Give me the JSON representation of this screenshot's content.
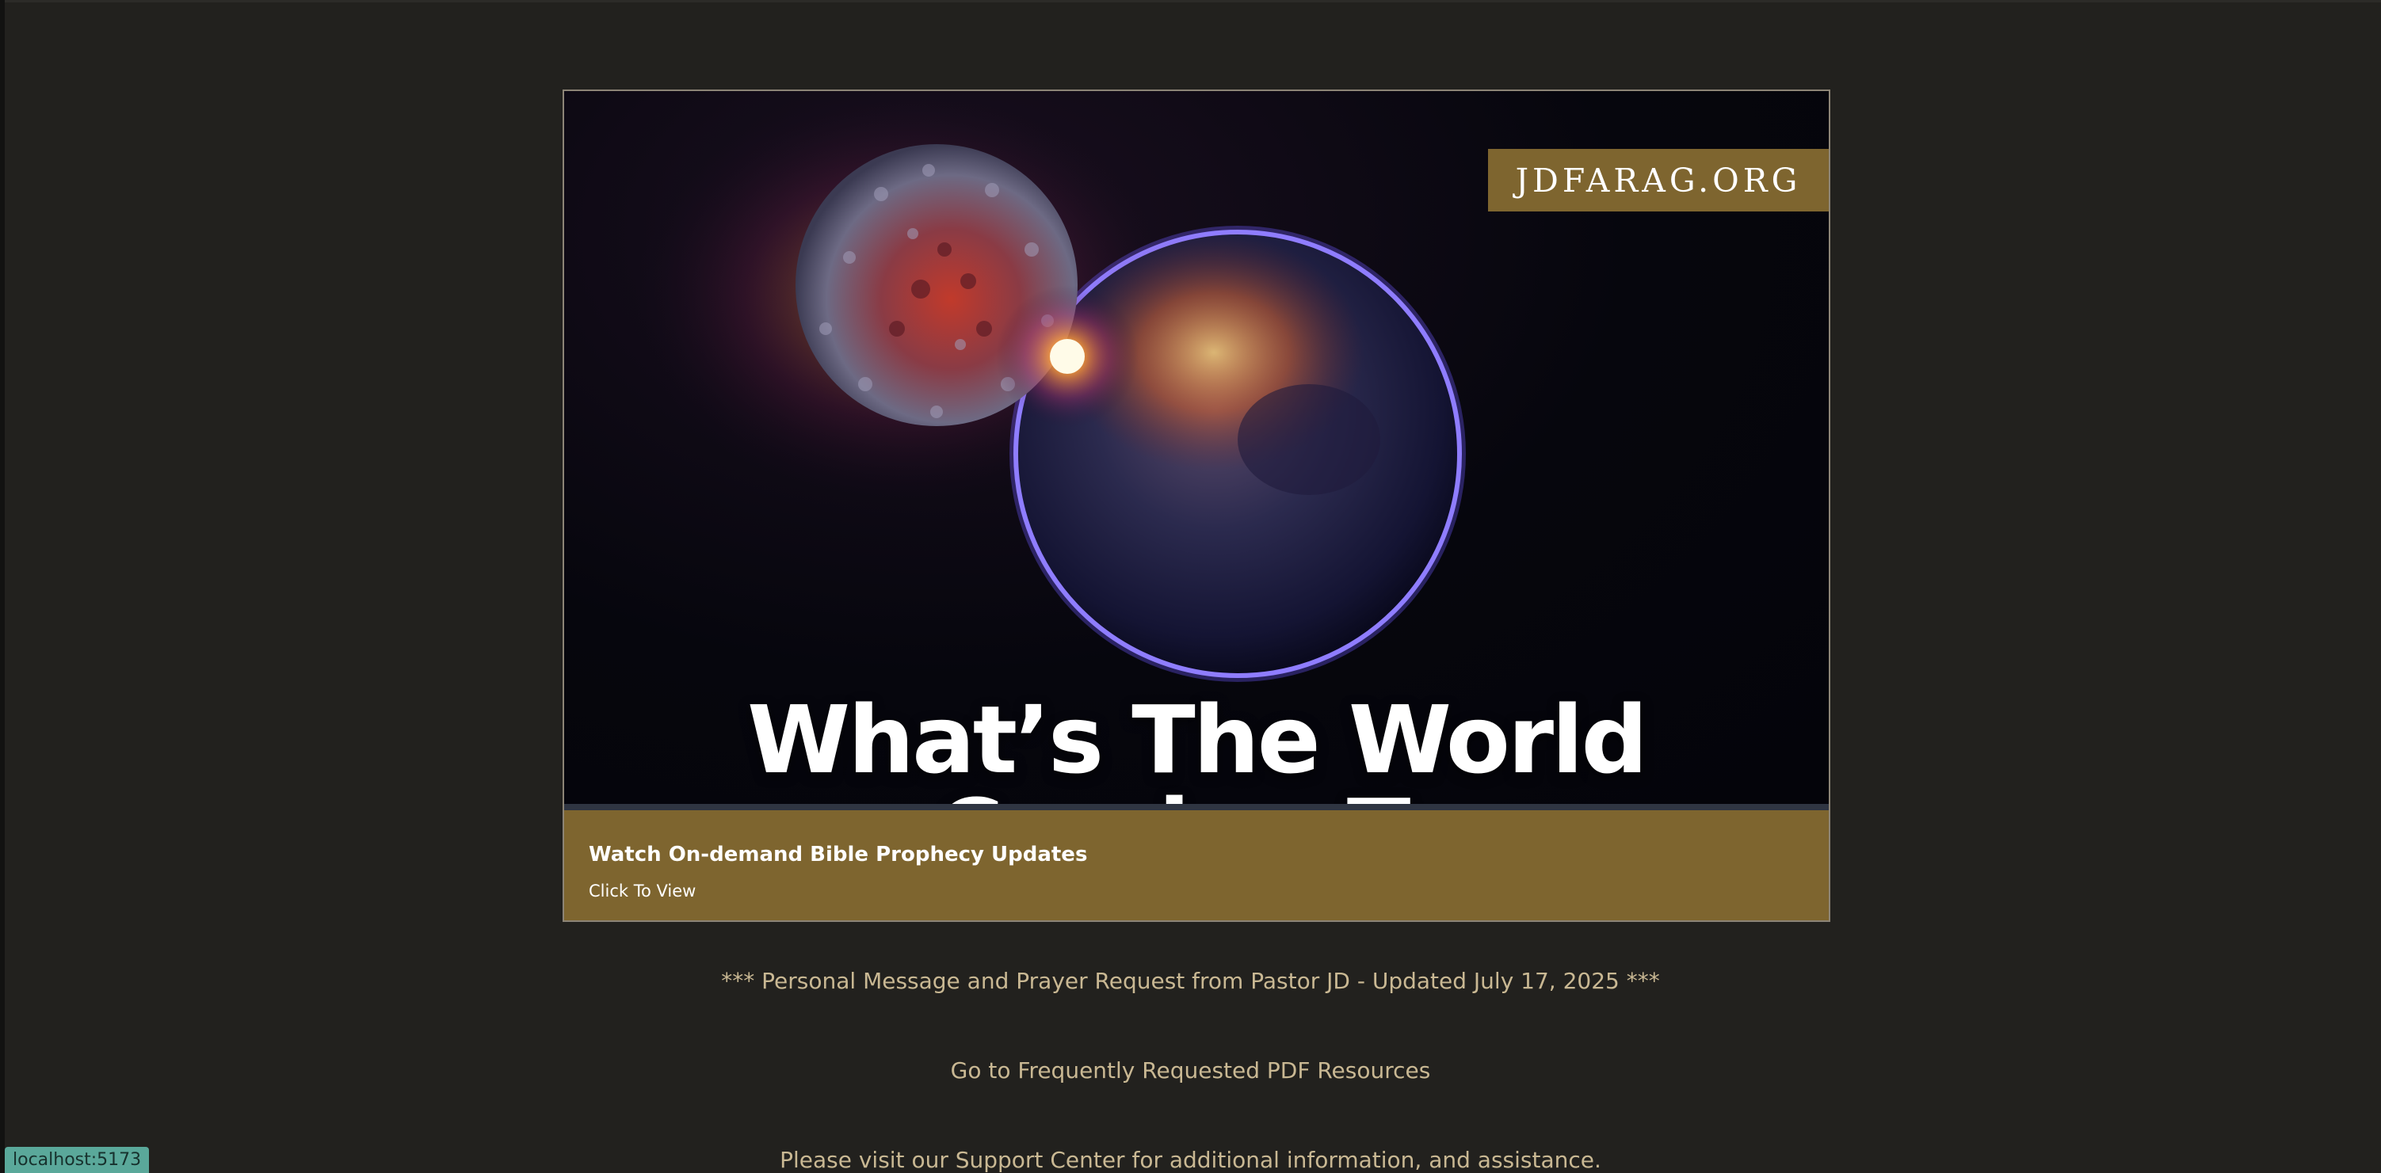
{
  "banner": {
    "logo": "JDFARAG.ORG",
    "headline": "What’s The World Coming To",
    "caption_title": "Watch On-demand Bible Prophecy Updates",
    "caption_subtitle": "Click To View",
    "image_subject": "virus-colliding-with-earth-illustration"
  },
  "links": {
    "personal_message": "*** Personal Message and Prayer Request from Pastor JD - Updated July 17, 2025 ***",
    "pdf_resources": "Go to Frequently Requested PDF Resources",
    "support_center": "Please visit our Support Center for additional information, and assistance."
  },
  "status_bar": {
    "url": "localhost:5173"
  },
  "colors": {
    "page_background": "#22211e",
    "gold_accent": "#7e652f",
    "link_text": "#c9b893",
    "status_pill": "#5aa89a"
  }
}
